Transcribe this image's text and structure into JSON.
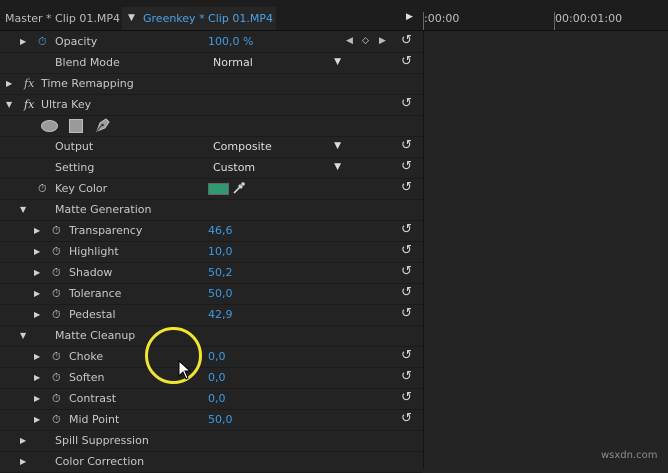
{
  "header": {
    "master_tab": "Master * Clip 01.MP4",
    "active_tab": "Greenkey * Clip 01.MP4",
    "timecodes": [
      ":00:00",
      "00:00:01:00"
    ]
  },
  "controls": {
    "opacity": {
      "label": "Opacity",
      "value": "100,0 %"
    },
    "blend_mode": {
      "label": "Blend Mode",
      "value": "Normal"
    },
    "time_remapping": {
      "fx": "fx",
      "label": "Time Remapping"
    },
    "ultra_key": {
      "fx": "fx",
      "label": "Ultra Key"
    },
    "output": {
      "label": "Output",
      "value": "Composite"
    },
    "setting": {
      "label": "Setting",
      "value": "Custom"
    },
    "key_color": {
      "label": "Key Color",
      "color": "#2f9a72"
    },
    "matte_generation": {
      "label": "Matte Generation",
      "params": [
        {
          "label": "Transparency",
          "value": "46,6"
        },
        {
          "label": "Highlight",
          "value": "10,0"
        },
        {
          "label": "Shadow",
          "value": "50,2"
        },
        {
          "label": "Tolerance",
          "value": "50,0"
        },
        {
          "label": "Pedestal",
          "value": "42,9"
        }
      ]
    },
    "matte_cleanup": {
      "label": "Matte Cleanup",
      "params": [
        {
          "label": "Choke",
          "value": "0,0"
        },
        {
          "label": "Soften",
          "value": "0,0"
        },
        {
          "label": "Contrast",
          "value": "0,0"
        },
        {
          "label": "Mid Point",
          "value": "50,0"
        }
      ]
    },
    "spill_suppression": {
      "label": "Spill Suppression"
    },
    "color_correction": {
      "label": "Color Correction"
    }
  },
  "icons": {
    "triangle_right": "▶",
    "triangle_down": "▼",
    "stopwatch": "⏱",
    "reset": "↺",
    "dropdown": "▼",
    "prev_kf": "◀",
    "add_kf": "◇",
    "next_kf": "▶"
  },
  "watermark": "wsxdn.com",
  "accent_color": "#3d9be6"
}
